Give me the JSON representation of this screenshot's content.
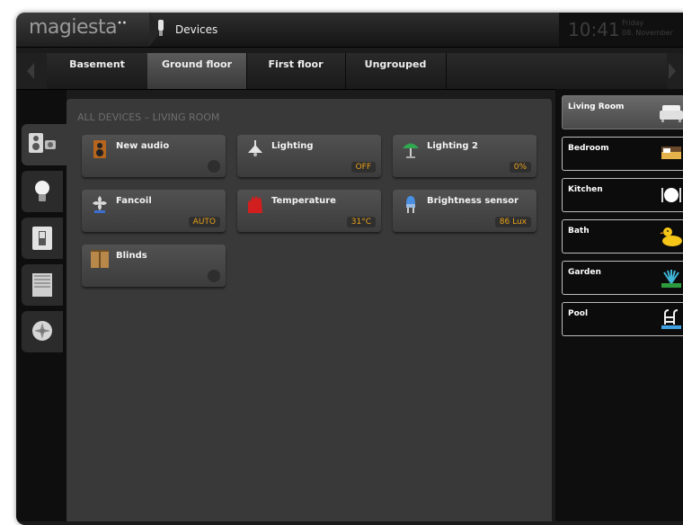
{
  "app": {
    "logo": "magiesta",
    "logo_mark": "••",
    "page_title": "Devices",
    "clock": "10:41",
    "day": "Friday",
    "date": "08. November"
  },
  "floors": [
    "Basement",
    "Ground floor",
    "First floor",
    "Ungrouped"
  ],
  "active_floor": "Ground floor",
  "categories": [
    "audio-lighting-icon",
    "bulb-icon",
    "switch-icon",
    "blinds-icon",
    "fan-icon"
  ],
  "main": {
    "title": "ALL DEVICES – LIVING ROOM",
    "devices": [
      {
        "label": "New audio",
        "status": "",
        "icon": "speaker-icon"
      },
      {
        "label": "Lighting",
        "status": "OFF",
        "icon": "ceiling-lamp-icon"
      },
      {
        "label": "Lighting 2",
        "status": "0%",
        "icon": "green-lamp-icon"
      },
      {
        "label": "Fancoil",
        "status": "AUTO",
        "icon": "fan-icon"
      },
      {
        "label": "Temperature",
        "status": "31°C",
        "icon": "heat-icon"
      },
      {
        "label": "Brightness sensor",
        "status": "86 Lux",
        "icon": "sensor-icon"
      },
      {
        "label": "Blinds",
        "status": "",
        "icon": "blinds-icon"
      }
    ]
  },
  "rooms": [
    {
      "label": "Living Room",
      "icon": "sofa-icon"
    },
    {
      "label": "Bedroom",
      "icon": "bed-icon"
    },
    {
      "label": "Kitchen",
      "icon": "plate-cutlery-icon"
    },
    {
      "label": "Bath",
      "icon": "rubber-duck-icon"
    },
    {
      "label": "Garden",
      "icon": "sprinkler-icon"
    },
    {
      "label": "Pool",
      "icon": "pool-ladder-icon"
    }
  ],
  "colors": {
    "status_accent": "#e8a21a",
    "active_tab": "#4a4a4a",
    "panel": "#393939"
  }
}
